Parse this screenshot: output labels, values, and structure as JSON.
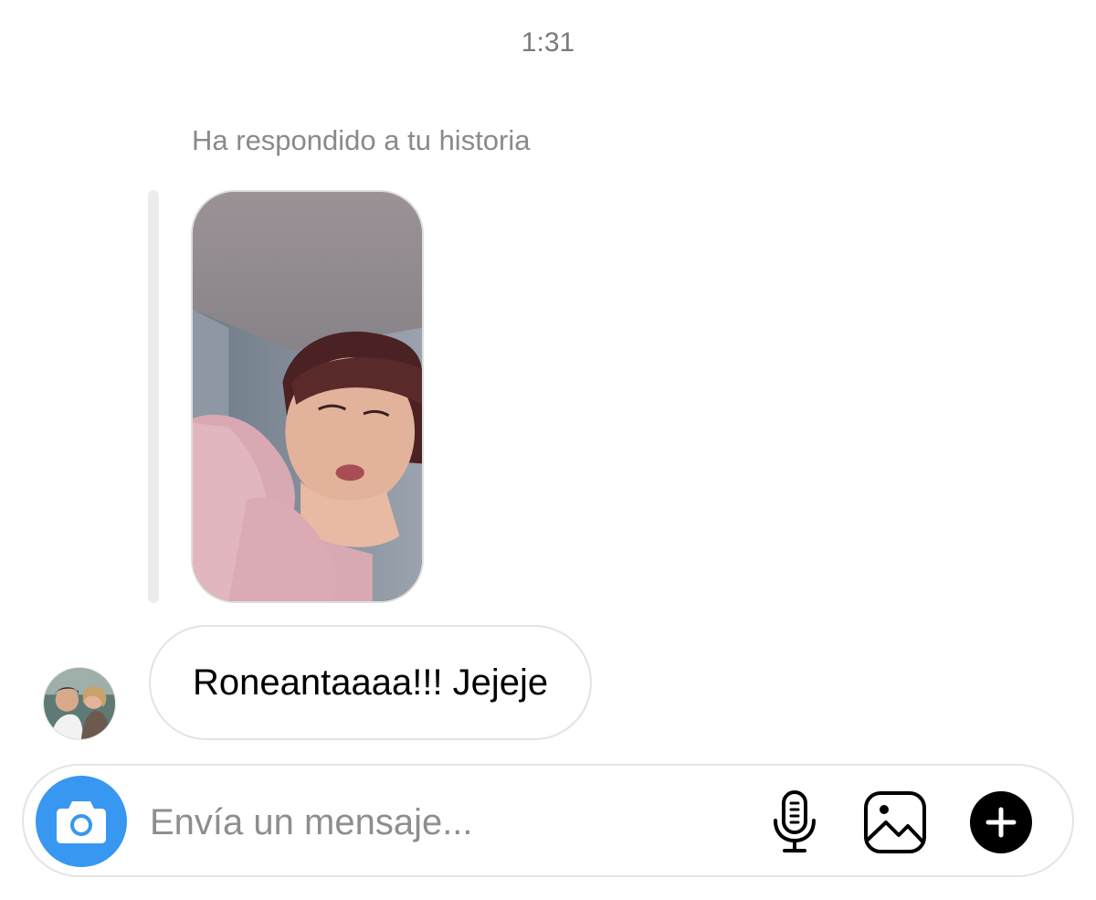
{
  "thread": {
    "timestamp": "1:31",
    "story_reply": {
      "label": "Ha respondido a tu historia"
    },
    "messages": [
      {
        "text": "Roneantaaaa!!! Jejeje"
      }
    ]
  },
  "composer": {
    "placeholder": "Envía un mensaje...",
    "value": "",
    "camera_icon": "camera-icon",
    "mic_icon": "microphone-icon",
    "gallery_icon": "image-gallery-icon",
    "plus_icon": "plus-icon"
  },
  "colors": {
    "accent": "#3897f0",
    "bubble_border": "#e3e3e3",
    "meta_text": "#8a8a8a"
  }
}
